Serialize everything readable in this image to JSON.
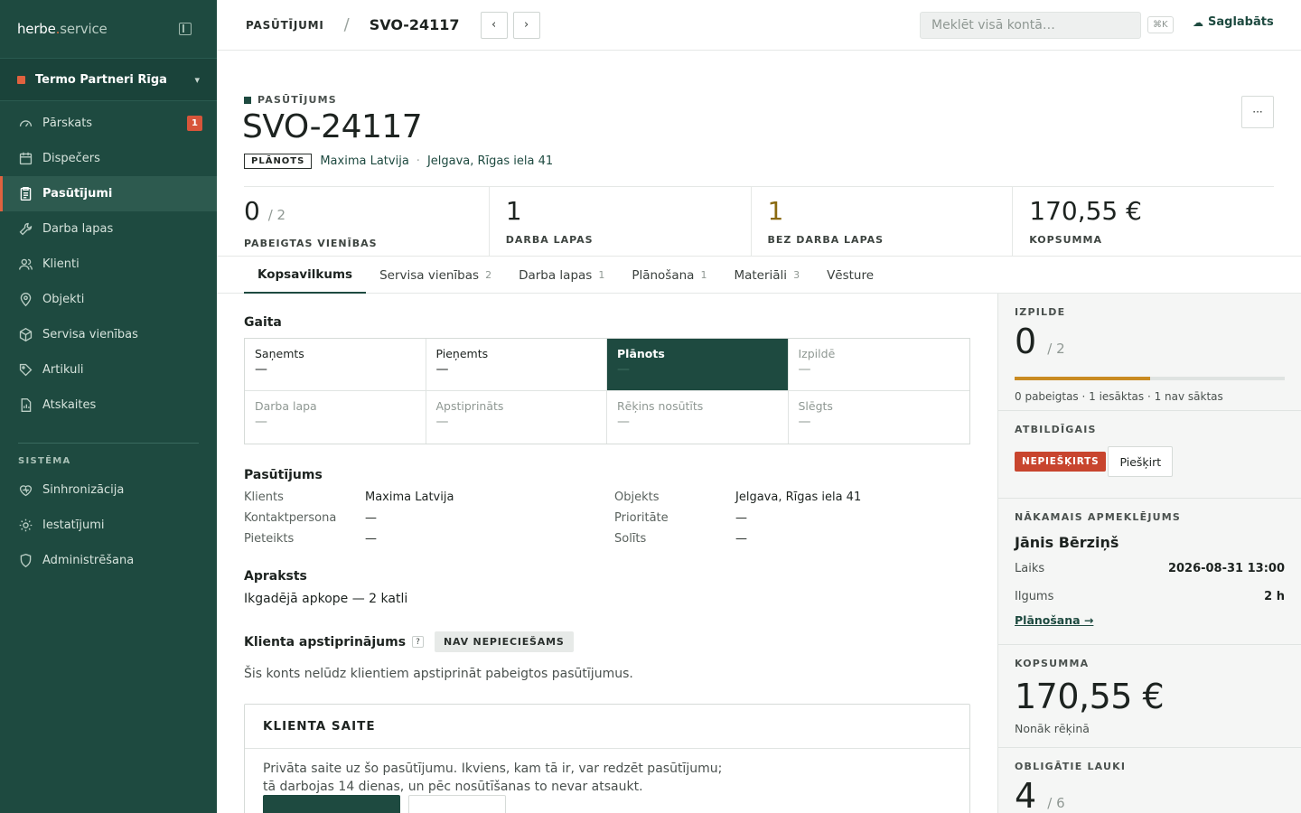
{
  "brand": {
    "name": "herbe",
    "dot": ".",
    "suffix": "service"
  },
  "org": {
    "name": "Termo Partneri Rīga"
  },
  "nav": {
    "items": [
      {
        "label": "Pārskats",
        "badge": "1"
      },
      {
        "label": "Dispečers"
      },
      {
        "label": "Pasūtījumi"
      },
      {
        "label": "Darba lapas"
      },
      {
        "label": "Klienti"
      },
      {
        "label": "Objekti"
      },
      {
        "label": "Servisa vienības"
      },
      {
        "label": "Artikuli"
      },
      {
        "label": "Atskaites"
      }
    ],
    "section": "SISTĒMA",
    "system": [
      {
        "label": "Sinhronizācija"
      },
      {
        "label": "Iestatījumi"
      },
      {
        "label": "Administrēšana"
      }
    ]
  },
  "topbar": {
    "crumb_parent": "PASŪTĪJUMI",
    "crumb_sep": "/",
    "crumb_current": "SVO-24117",
    "prev_icon": "‹",
    "next_icon": "›",
    "search_placeholder": "Meklēt visā kontā…",
    "shortcut": "⌘K",
    "saved": "Saglabāts"
  },
  "header": {
    "eyebrow": "PASŪTĪJUMS",
    "title": "SVO-24117",
    "more": "···",
    "status": "PLĀNOTS",
    "client": "Maxima Latvija",
    "dot": "·",
    "location": "Jelgava, Rīgas iela 41"
  },
  "stats": [
    {
      "value": "0",
      "of": "/ 2",
      "label": "PABEIGTAS VIENĪBAS"
    },
    {
      "value": "1",
      "label": "DARBA LAPAS"
    },
    {
      "value": "1",
      "label": "BEZ DARBA LAPAS"
    },
    {
      "value": "170,55 €",
      "label": "KOPSUMMA"
    }
  ],
  "tabs": [
    {
      "label": "Kopsavilkums",
      "count": ""
    },
    {
      "label": "Servisa vienības",
      "count": "2"
    },
    {
      "label": "Darba lapas",
      "count": "1"
    },
    {
      "label": "Plānošana",
      "count": "1"
    },
    {
      "label": "Materiāli",
      "count": "3"
    },
    {
      "label": "Vēsture",
      "count": ""
    }
  ],
  "progress": {
    "title": "Gaita",
    "steps": [
      {
        "label": "Saņemts",
        "value": "—"
      },
      {
        "label": "Pieņemts",
        "value": "—"
      },
      {
        "label": "Plānots",
        "value": "—"
      },
      {
        "label": "Izpildē",
        "value": "—"
      },
      {
        "label": "Darba lapa",
        "value": "—"
      },
      {
        "label": "Apstiprināts",
        "value": "—"
      },
      {
        "label": "Rēķins nosūtīts",
        "value": "—"
      },
      {
        "label": "Slēgts",
        "value": "—"
      }
    ]
  },
  "order": {
    "title": "Pasūtījums",
    "fields": {
      "client_k": "Klients",
      "client_v": "Maxima Latvija",
      "object_k": "Objekts",
      "object_v": "Jelgava, Rīgas iela 41",
      "contact_k": "Kontaktpersona",
      "contact_v": "—",
      "priority_k": "Prioritāte",
      "priority_v": "—",
      "reported_k": "Pieteikts",
      "reported_v": "—",
      "step_k": "Solīts",
      "step_v": "—"
    }
  },
  "description": {
    "title": "Apraksts",
    "text": "Ikgadējā apkope — 2 katli"
  },
  "confirmation": {
    "title": "Klienta apstiprinājums",
    "help": "?",
    "badge": "NAV NEPIECIEŠAMS",
    "text": "Šis konts nelūdz klientiem apstiprināt pabeigtos pasūtījumus."
  },
  "client_link": {
    "title": "KLIENTA SAITE",
    "text": "Privāta saite uz šo pasūtījumu. Ikviens, kam tā ir, var redzēt pasūtījumu; tā darbojas 14 dienas, un pēc nosūtīšanas to nevar atsaukt."
  },
  "right": {
    "execution": {
      "label": "IZPILDE",
      "value": "0",
      "of": "/ 2",
      "progress": 0.5,
      "summary": "0 pabeigtas · 1 iesāktas · 1 nav sāktas"
    },
    "responsible": {
      "label": "ATBILDĪGAIS",
      "badge": "NEPIEŠĶIRTS",
      "button": "Piešķirt"
    },
    "next_visit": {
      "label": "NĀKAMAIS APMEKLĒJUMS",
      "name": "Jānis Bērziņš",
      "time_k": "Laiks",
      "time_v": "2026-08-31 13:00",
      "dur_k": "Ilgums",
      "dur_v": "2 h",
      "link": "Plānošana →"
    },
    "total": {
      "label": "KOPSUMMA",
      "value": "170,55 €",
      "note": "Nonāk rēķinā"
    },
    "required": {
      "label": "OBLIGĀTIE LAUKI",
      "value": "4",
      "of": "/ 6"
    }
  },
  "colors": {
    "sidebar": "#1e4a40",
    "accent": "#e0623f",
    "progress_fill": "#c98b22",
    "danger": "#c8452e"
  }
}
